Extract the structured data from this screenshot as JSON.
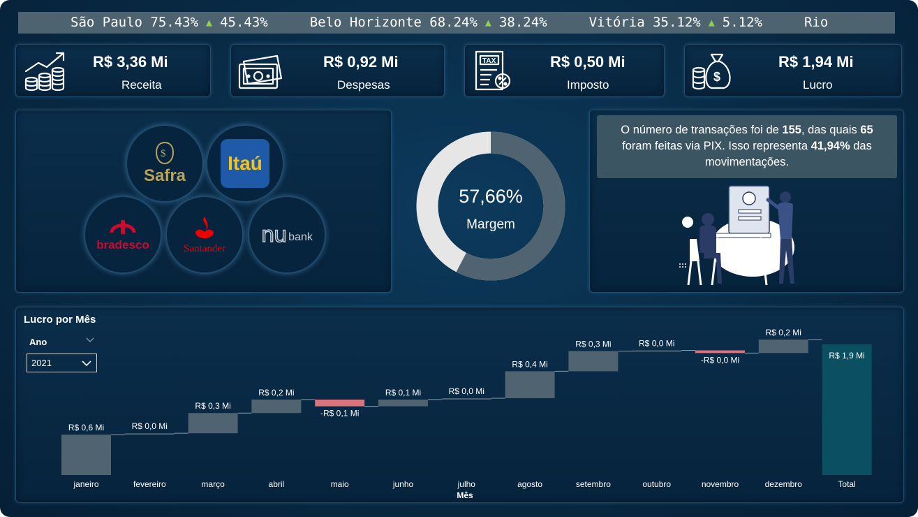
{
  "ticker": [
    {
      "city": "São Paulo",
      "value": "75.43%",
      "delta": "45.43%"
    },
    {
      "city": "Belo Horizonte",
      "value": "68.24%",
      "delta": "38.24%"
    },
    {
      "city": "Vitória",
      "value": "35.12%",
      "delta": "5.12%"
    },
    {
      "city": "Rio",
      "value": "",
      "delta": ""
    }
  ],
  "kpis": [
    {
      "value": "R$ 3,36 Mi",
      "label": "Receita",
      "icon": "revenue-growth-icon"
    },
    {
      "value": "R$ 0,92 Mi",
      "label": "Despesas",
      "icon": "banknotes-icon"
    },
    {
      "value": "R$ 0,50 Mi",
      "label": "Imposto",
      "icon": "tax-document-icon"
    },
    {
      "value": "R$ 1,94 Mi",
      "label": "Lucro",
      "icon": "money-bag-icon"
    }
  ],
  "banks": [
    {
      "name": "Safra",
      "color": "#b9a25a"
    },
    {
      "name": "Itaú",
      "color": "#f0c21a"
    },
    {
      "name": "bradesco",
      "color": "#cc092f"
    },
    {
      "name": "Santander",
      "color": "#ec0000"
    },
    {
      "name": "nu",
      "suffix": "bank",
      "color": "#c7ccd2"
    }
  ],
  "donut": {
    "value_label": "57,66%",
    "caption": "Margem",
    "fraction": 0.5766,
    "filled_color": "#4f6470",
    "rest_color": "#e6e6e6"
  },
  "summary": {
    "p1": "O número de transações foi de ",
    "n1": "155",
    "p2": ", das quais ",
    "n2": "65",
    "p3": " foram feitas via PIX. Isso representa ",
    "n3": "41,94%",
    "p4": " das movimentações."
  },
  "chart": {
    "title": "Lucro por Mês",
    "xlabel": "Mês",
    "slicer": {
      "label": "Ano",
      "selected": "2021"
    }
  },
  "chart_data": {
    "type": "waterfall",
    "categories": [
      "janeiro",
      "fevereiro",
      "março",
      "abril",
      "maio",
      "junho",
      "julho",
      "agosto",
      "setembro",
      "outubro",
      "novembro",
      "dezembro",
      "Total"
    ],
    "values": [
      0.6,
      0.02,
      0.3,
      0.2,
      -0.1,
      0.1,
      0.02,
      0.4,
      0.3,
      0.01,
      -0.04,
      0.2,
      1.94
    ],
    "labels": [
      "R$ 0,6 Mi",
      "R$ 0,0 Mi",
      "R$ 0,3 Mi",
      "R$ 0,2 Mi",
      "-R$ 0,1 Mi",
      "R$ 0,1 Mi",
      "R$ 0,0 Mi",
      "R$ 0,4 Mi",
      "R$ 0,3 Mi",
      "R$ 0,0 Mi",
      "-R$ 0,0 Mi",
      "R$ 0,2 Mi",
      "R$ 1,9 Mi"
    ],
    "colors": {
      "increase": "#4f6470",
      "decrease": "#d9747f",
      "total": "#0b4f63"
    },
    "xlabel": "Mês",
    "ylabel": "",
    "ylim": [
      0,
      2.0
    ]
  }
}
